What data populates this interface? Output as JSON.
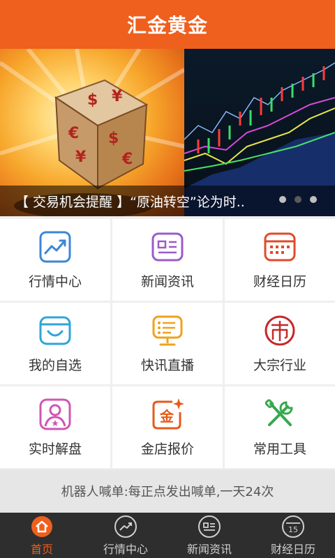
{
  "header": {
    "title": "汇金黄金"
  },
  "banner": {
    "caption": "【 交易机会提醒 】“原油转空”论为时...",
    "dots": 3,
    "active_dot": 1
  },
  "grid": [
    {
      "label": "行情中心",
      "icon": "trend-chart-icon",
      "color": "#3b86d8"
    },
    {
      "label": "新闻资讯",
      "icon": "news-icon",
      "color": "#9a5cc8"
    },
    {
      "label": "财经日历",
      "icon": "calendar-icon",
      "color": "#e14a2b"
    },
    {
      "label": "我的自选",
      "icon": "basket-icon",
      "color": "#2ea5d9"
    },
    {
      "label": "快讯直播",
      "icon": "broadcast-icon",
      "color": "#f0a21b"
    },
    {
      "label": "大宗行业",
      "icon": "market-seal-icon",
      "color": "#c62828"
    },
    {
      "label": "实时解盘",
      "icon": "analyst-icon",
      "color": "#d154b3"
    },
    {
      "label": "金店报价",
      "icon": "gold-store-icon",
      "color": "#e55a1a"
    },
    {
      "label": "常用工具",
      "icon": "tools-icon",
      "color": "#37a84f"
    }
  ],
  "notice": {
    "text": "机器人喊单:每正点发出喊单,一天24次"
  },
  "tabbar": [
    {
      "label": "首页",
      "icon": "home-icon",
      "active": true
    },
    {
      "label": "行情中心",
      "icon": "trend-icon",
      "active": false
    },
    {
      "label": "新闻资讯",
      "icon": "news-icon",
      "active": false
    },
    {
      "label": "财经日历",
      "icon": "calendar-15-icon",
      "active": false,
      "badge": "15"
    }
  ],
  "colors": {
    "brand": "#ef5f1d",
    "tabbar_bg": "#2e2e2e"
  }
}
